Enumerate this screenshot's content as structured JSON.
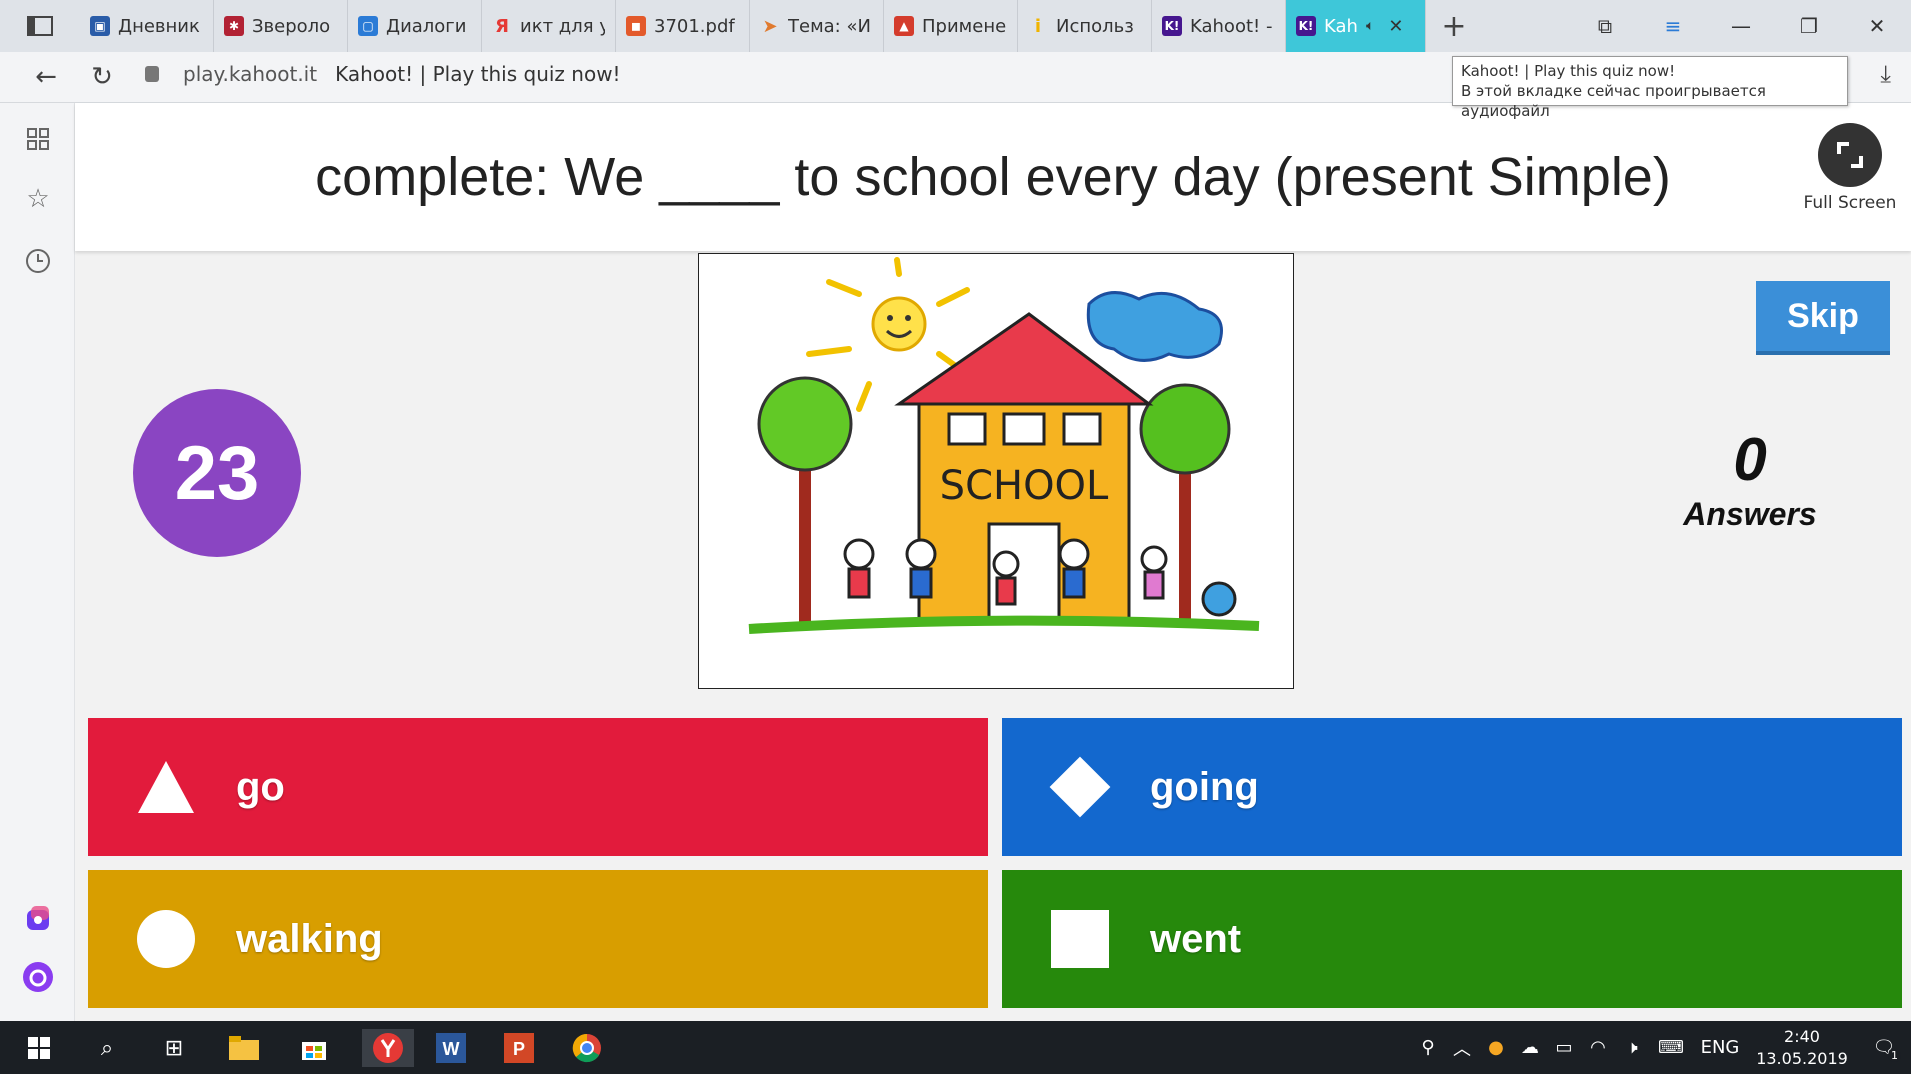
{
  "browser": {
    "tabs": [
      {
        "title": "Дневник",
        "fav_color": "#2a5ca8",
        "fav_glyph": "▣"
      },
      {
        "title": "Звероло",
        "fav_color": "#b22234",
        "fav_glyph": "✱"
      },
      {
        "title": "Диалоги",
        "fav_color": "#2b7bd6",
        "fav_glyph": "▢"
      },
      {
        "title": "икт для у",
        "fav_color": "#e53935",
        "fav_glyph": "Я"
      },
      {
        "title": "3701.pdf",
        "fav_color": "#e35a2b",
        "fav_glyph": "◼"
      },
      {
        "title": "Тема: «И",
        "fav_color": "#e07a2e",
        "fav_glyph": "➤"
      },
      {
        "title": "Примене",
        "fav_color": "#d43c2c",
        "fav_glyph": "▲"
      },
      {
        "title": "Использ",
        "fav_color": "#f0b400",
        "fav_glyph": "i"
      },
      {
        "title": "Kahoot! -",
        "fav_color": "#46178f",
        "fav_glyph": "K!"
      },
      {
        "title": "Kah",
        "fav_color": "#46178f",
        "fav_glyph": "K!",
        "active": true
      }
    ],
    "address": {
      "host": "play.kahoot.it",
      "page_title": "Kahoot! | Play this quiz now!"
    },
    "tooltip": {
      "line1": "Kahoot! | Play this quiz now!",
      "line2": "В этой вкладке сейчас проигрывается аудиофайл"
    }
  },
  "quiz": {
    "question": "complete: We ____ to school every day (present Simple)",
    "fullscreen_label": "Full Screen",
    "timer": "23",
    "skip_label": "Skip",
    "answers_count": "0",
    "answers_label": "Answers",
    "image_text": "SCHOOL",
    "options": [
      {
        "shape": "triangle",
        "label": "go",
        "color": "#e21b3c"
      },
      {
        "shape": "diamond",
        "label": "going",
        "color": "#1368ce"
      },
      {
        "shape": "circle",
        "label": "walking",
        "color": "#d89e00"
      },
      {
        "shape": "square",
        "label": "went",
        "color": "#26890c"
      }
    ]
  },
  "taskbar": {
    "lang": "ENG",
    "time": "2:40",
    "date": "13.05.2019",
    "notif_count": "1"
  }
}
